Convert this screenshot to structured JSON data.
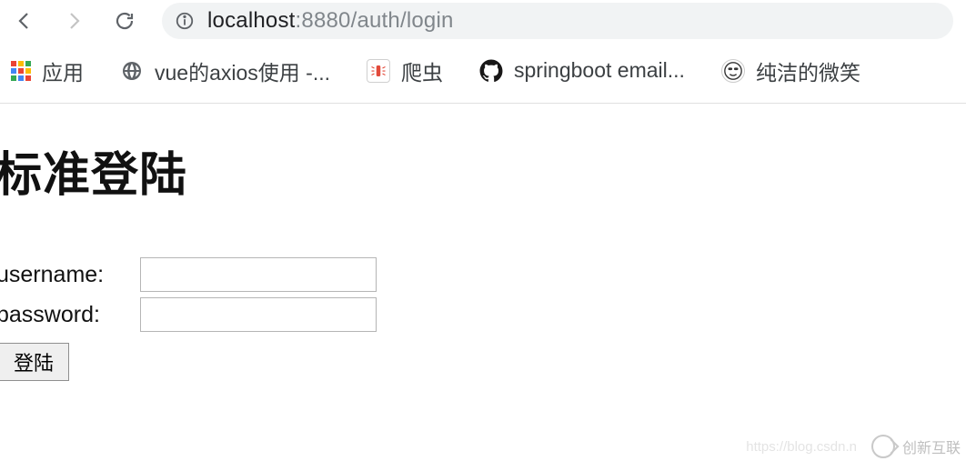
{
  "browser": {
    "url_host": "localhost",
    "url_port_path": ":8880/auth/login"
  },
  "bookmarks": {
    "apps": "应用",
    "item1": "vue的axios使用 -...",
    "item2": "爬虫",
    "item3": "springboot email...",
    "item4": "纯洁的微笑"
  },
  "page": {
    "title": "标准登陆",
    "username_label": "username:",
    "password_label": "password:",
    "submit_label": "登陆"
  },
  "watermark": {
    "url": "https://blog.csdn.n",
    "brand": "创新互联"
  }
}
